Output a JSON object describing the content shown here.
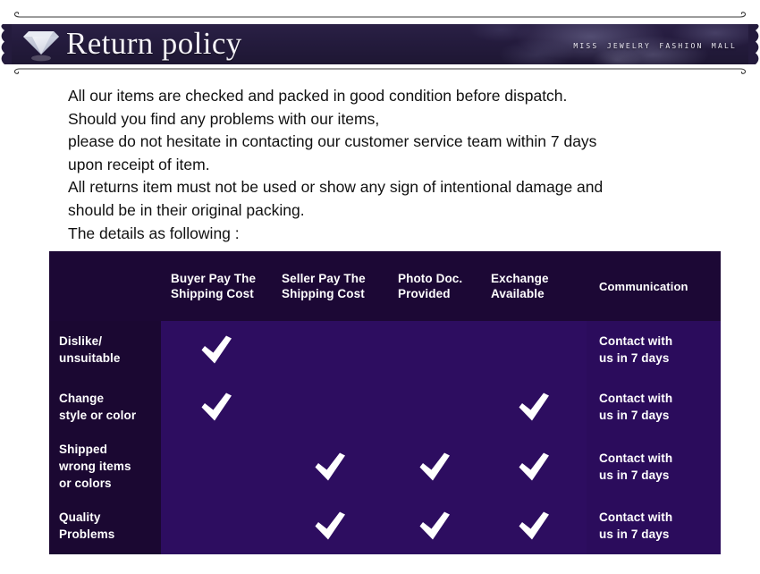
{
  "header": {
    "title": "Return policy",
    "brand": "Miss Jewelry Fashion Mall",
    "icon": "diamond-icon",
    "colors": {
      "banner_dark": "#241b3d",
      "banner_light": "#2a2045",
      "title_text": "#f4f2f8"
    }
  },
  "policy_text": {
    "lines": [
      "All our items are checked and packed in good condition before dispatch.",
      "Should you find any problems with our items,",
      "please do not hesitate in contacting our customer service team within 7 days",
      "upon receipt of item.",
      "All returns item must not be used or show any sign of intentional damage and",
      "should be in their original packing.",
      "The details as following :"
    ]
  },
  "table": {
    "colors": {
      "label_column": "#1b0832",
      "header": "#1c0835",
      "cell": "#2d0d60",
      "divider": "#ffffff",
      "row_separator": "#a992d6",
      "text": "#ffffff"
    },
    "headers": [
      "",
      "Buyer Pay The Shipping Cost",
      "Seller Pay The Shipping Cost",
      "Photo Doc. Provided",
      "Exchange Available",
      "Communication"
    ],
    "header_lines": [
      [
        "",
        ""
      ],
      [
        "Buyer Pay The",
        "Shipping Cost"
      ],
      [
        "Seller Pay The",
        "Shipping Cost"
      ],
      [
        "Photo Doc.",
        "Provided"
      ],
      [
        "Exchange",
        "Available"
      ],
      [
        "Communication",
        ""
      ]
    ],
    "rows": [
      {
        "label_lines": [
          "Dislike/",
          "unsuitable"
        ],
        "buyer_pay": true,
        "seller_pay": false,
        "photo_doc": false,
        "exchange": false,
        "communication_lines": [
          "Contact with",
          "us in 7 days"
        ]
      },
      {
        "label_lines": [
          "Change",
          "style or color"
        ],
        "buyer_pay": true,
        "seller_pay": false,
        "photo_doc": false,
        "exchange": true,
        "communication_lines": [
          "Contact with",
          "us in 7 days"
        ]
      },
      {
        "label_lines": [
          "Shipped",
          "wrong items",
          "or colors"
        ],
        "buyer_pay": false,
        "seller_pay": true,
        "photo_doc": true,
        "exchange": true,
        "communication_lines": [
          "Contact with",
          "us in 7 days"
        ]
      },
      {
        "label_lines": [
          "Quality",
          "Problems"
        ],
        "buyer_pay": false,
        "seller_pay": true,
        "photo_doc": true,
        "exchange": true,
        "communication_lines": [
          "Contact with",
          "us in 7 days"
        ]
      }
    ]
  }
}
